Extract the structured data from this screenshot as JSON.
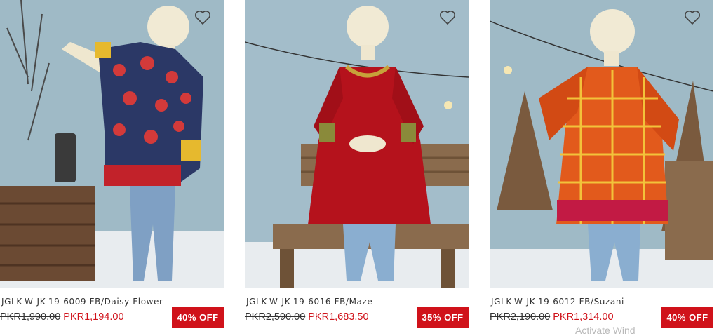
{
  "products": [
    {
      "title": "JGLK-W-JK-19-6009 FB/Daisy Flower",
      "old_price": "PKR1,990.00",
      "new_price": "PKR1,194.00",
      "discount": "40% OFF",
      "image_alt": "Girl mannequin in navy floral kurti with jeans"
    },
    {
      "title": "JGLK-W-JK-19-6016 FB/Maze",
      "old_price": "PKR2,590.00",
      "new_price": "PKR1,683.50",
      "discount": "35% OFF",
      "image_alt": "Girl mannequin in red embroidered kurti with jeans"
    },
    {
      "title": "JGLK-W-JK-19-6012 FB/Suzani",
      "old_price": "PKR2,190.00",
      "new_price": "PKR1,314.00",
      "discount": "40% OFF",
      "image_alt": "Girl mannequin in orange suzani print kurti with jeans"
    }
  ],
  "icons": {
    "wishlist": "heart-outline-icon"
  },
  "colors": {
    "sale_red": "#d0121a",
    "badge_text": "#ffffff"
  },
  "overlay": {
    "watermark": "Activate Wind"
  }
}
